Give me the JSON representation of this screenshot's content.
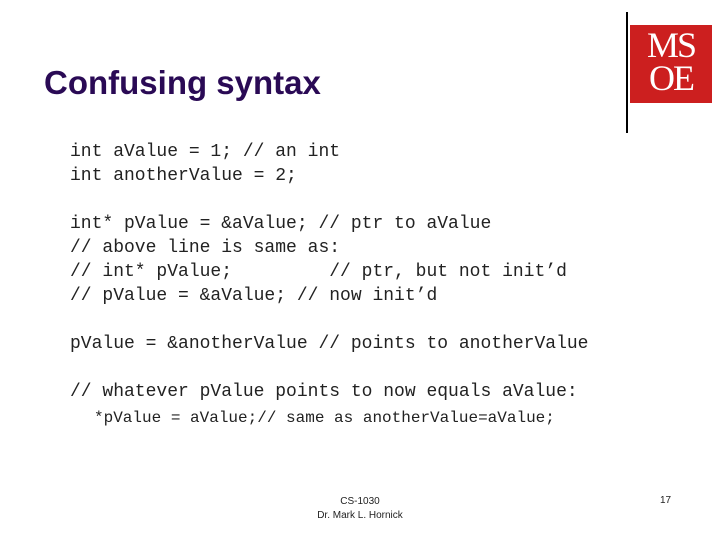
{
  "slide": {
    "title": "Confusing syntax",
    "logo": {
      "line1": "MS",
      "line2": "OE",
      "brand_color": "#cc1f1f"
    },
    "code_lines": [
      "int aValue = 1; // an int",
      "int anotherValue = 2;",
      "int* pValue = &aValue; // ptr to aValue",
      "// above line is same as:",
      "// int* pValue;         // ptr, but not init’d",
      "// pValue = &aValue; // now init’d",
      "pValue = &anotherValue // points to anotherValue",
      "// whatever pValue points to now equals aValue:",
      "*pValue = aValue;// same as anotherValue=aValue;"
    ],
    "footer": {
      "course": "CS-1030",
      "author": "Dr. Mark L. Hornick",
      "page_number": "17"
    }
  }
}
